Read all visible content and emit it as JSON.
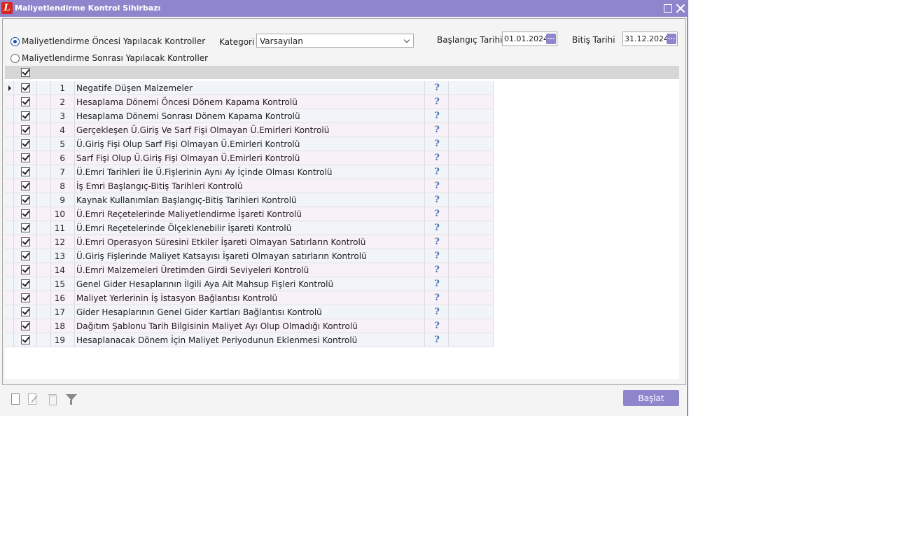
{
  "window": {
    "title": "Maliyetlendirme Kontrol Sihirbazı",
    "app_icon_letter": "L"
  },
  "options": {
    "radio_before": "Maliyetlendirme Öncesi Yapılacak Kontroller",
    "radio_after": "Maliyetlendirme Sonrası Yapılacak Kontroller",
    "selected": "radio_before"
  },
  "kategori": {
    "label": "Kategori",
    "value": "Varsayılan"
  },
  "start_date": {
    "label": "Başlangıç Tarihi",
    "value": "01.01.2024",
    "button": "..."
  },
  "end_date": {
    "label": "Bitiş Tarihi",
    "value": "31.12.2024",
    "button": "..."
  },
  "grid": {
    "rows": [
      {
        "num": "1",
        "text": "Negatife Düşen Malzemeler"
      },
      {
        "num": "2",
        "text": "Hesaplama Dönemi Öncesi Dönem Kapama Kontrolü"
      },
      {
        "num": "3",
        "text": "Hesaplama Dönemi Sonrası Dönem Kapama Kontrolü"
      },
      {
        "num": "4",
        "text": "Gerçekleşen Ü.Giriş Ve Sarf Fişi Olmayan Ü.Emirleri Kontrolü"
      },
      {
        "num": "5",
        "text": "Ü.Giriş Fişi Olup Sarf Fişi Olmayan Ü.Emirleri Kontrolü"
      },
      {
        "num": "6",
        "text": "Sarf Fişi Olup Ü.Giriş Fişi Olmayan Ü.Emirleri Kontrolü"
      },
      {
        "num": "7",
        "text": "Ü.Emri Tarihleri İle Ü.Fişlerinin Aynı Ay İçinde Olması Kontrolü"
      },
      {
        "num": "8",
        "text": "İş Emri Başlangıç-Bitiş Tarihleri Kontrolü"
      },
      {
        "num": "9",
        "text": "Kaynak Kullanımları Başlangıç-Bitiş Tarihleri Kontrolü"
      },
      {
        "num": "10",
        "text": "Ü.Emri Reçetelerinde Maliyetlendirme İşareti Kontrolü"
      },
      {
        "num": "11",
        "text": "Ü.Emri Reçetelerinde Ölçeklenebilir İşareti Kontrolü"
      },
      {
        "num": "12",
        "text": "Ü.Emri Operasyon Süresini Etkiler İşareti Olmayan Satırların Kontrolü"
      },
      {
        "num": "13",
        "text": "Ü.Giriş Fişlerinde Maliyet Katsayısı İşareti Olmayan satırların Kontrolü"
      },
      {
        "num": "14",
        "text": "Ü.Emri Malzemeleri Üretimden Girdi Seviyeleri Kontrolü"
      },
      {
        "num": "15",
        "text": "Genel Gider Hesaplarının İlgili Aya Ait Mahsup Fişleri Kontrolü"
      },
      {
        "num": "16",
        "text": "Maliyet Yerlerinin İş İstasyon Bağlantısı Kontrolü"
      },
      {
        "num": "17",
        "text": "Gider Hesaplarının Genel Gider Kartları Bağlantısı Kontrolü"
      },
      {
        "num": "18",
        "text": "Dağıtım Şablonu Tarih Bilgisinin Maliyet Ayı Olup Olmadığı Kontrolü"
      },
      {
        "num": "19",
        "text": "Hesaplanacak Dönem İçin Maliyet Periyodunun Eklenmesi Kontrolü"
      }
    ],
    "help_glyph": "?"
  },
  "footer": {
    "start_button": "Başlat"
  },
  "colors": {
    "accent": "#8e86cc",
    "app_icon": "#d7261b"
  }
}
